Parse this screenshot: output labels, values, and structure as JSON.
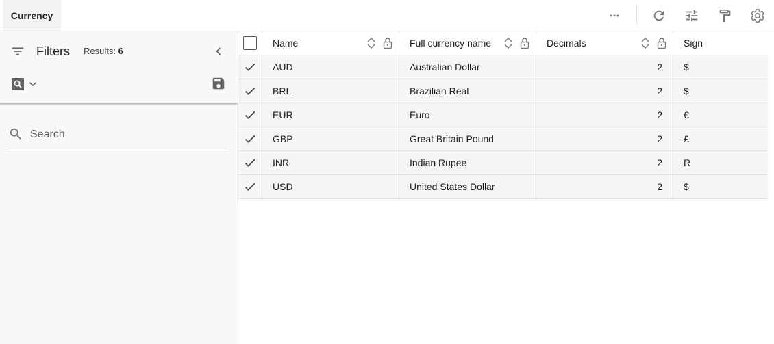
{
  "topbar": {
    "tab_label": "Currency"
  },
  "sidebar": {
    "title": "Filters",
    "results_label": "Results:",
    "results_count": "6",
    "search_placeholder": "Search"
  },
  "grid": {
    "columns": [
      "Name",
      "Full currency name",
      "Decimals",
      "Sign"
    ],
    "rows": [
      {
        "name": "AUD",
        "full": "Australian Dollar",
        "decimals": "2",
        "sign": "$"
      },
      {
        "name": "BRL",
        "full": "Brazilian Real",
        "decimals": "2",
        "sign": "$"
      },
      {
        "name": "EUR",
        "full": "Euro",
        "decimals": "2",
        "sign": "€"
      },
      {
        "name": "GBP",
        "full": "Great Britain Pound",
        "decimals": "2",
        "sign": "£"
      },
      {
        "name": "INR",
        "full": "Indian Rupee",
        "decimals": "2",
        "sign": "R"
      },
      {
        "name": "USD",
        "full": "United States Dollar",
        "decimals": "2",
        "sign": "$"
      }
    ]
  },
  "icons": {
    "toolbar": [
      "more-horizontal-icon",
      "refresh-icon",
      "tune-icon",
      "format-paint-icon",
      "settings-gear-icon"
    ],
    "sidebar": [
      "filter-list-icon",
      "chevron-left-icon",
      "saved-search-icon",
      "chevron-down-icon",
      "save-icon",
      "search-icon"
    ],
    "grid": [
      "sort-icon",
      "lock-icon",
      "check-icon"
    ]
  },
  "colors": {
    "icon": "#757575",
    "sidebar_bg": "#f8f8f8",
    "row_bg": "#f5f5f5",
    "border": "#e0e0e0"
  }
}
